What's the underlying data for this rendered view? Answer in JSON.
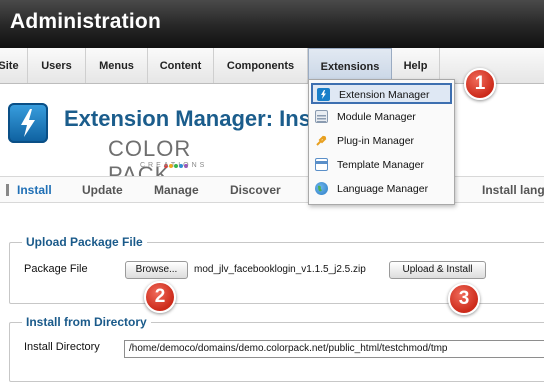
{
  "header": {
    "title": "Administration"
  },
  "menubar": {
    "items": [
      "Site",
      "Users",
      "Menus",
      "Content",
      "Components",
      "Extensions",
      "Help"
    ],
    "active": "Extensions"
  },
  "page": {
    "title": "Extension Manager: Ins"
  },
  "brand": {
    "name": "COLOR PACK",
    "tagline": "CREATIONS"
  },
  "tabs": [
    "Install",
    "Update",
    "Manage",
    "Discover",
    "Install lang"
  ],
  "upload": {
    "legend": "Upload Package File",
    "label": "Package File",
    "browse_label": "Browse...",
    "file_name": "mod_jlv_facebooklogin_v1.1.5_j2.5.zip",
    "install_label": "Upload & Install"
  },
  "directory": {
    "legend": "Install from Directory",
    "label": "Install Directory",
    "value": "/home/democo/domains/demo.colorpack.net/public_html/testchmod/tmp"
  },
  "dropdown": {
    "items": [
      {
        "label": "Extension Manager",
        "icon": "extension-manager-icon",
        "color": "#1a7fc9"
      },
      {
        "label": "Module Manager",
        "icon": "module-manager-icon",
        "color": "#8a9bb0"
      },
      {
        "label": "Plug-in Manager",
        "icon": "plugin-manager-icon",
        "color": "#e8a020"
      },
      {
        "label": "Template Manager",
        "icon": "template-manager-icon",
        "color": "#5a8fc8"
      },
      {
        "label": "Language Manager",
        "icon": "language-manager-icon",
        "color": "#2b7cc4"
      }
    ]
  },
  "callouts": [
    "1",
    "2",
    "3"
  ],
  "colors": {
    "accent": "#1b5d8c",
    "callout": "#d8392a"
  }
}
